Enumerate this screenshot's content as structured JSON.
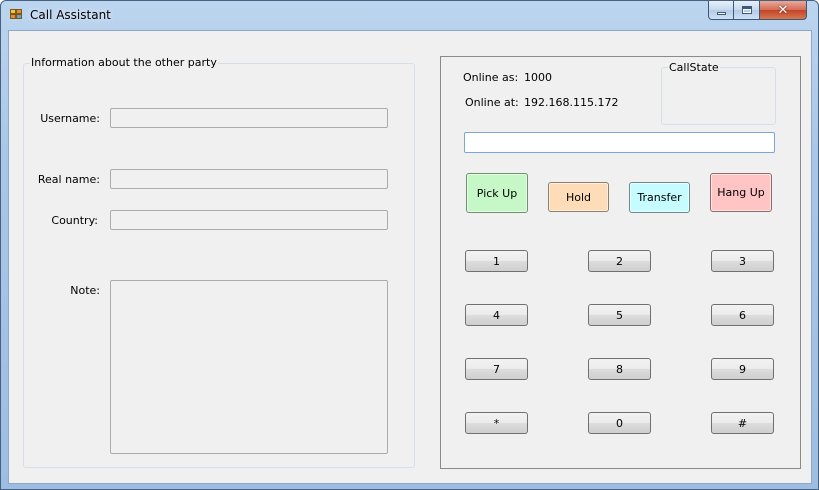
{
  "window": {
    "title": "Call Assistant"
  },
  "caption": {
    "minimize_icon": "minimize-icon",
    "maximize_icon": "maximize-icon",
    "close_icon": "close-icon",
    "close_glyph": "✕"
  },
  "other_party": {
    "legend": "Information about the other party",
    "username_label": "Username:",
    "username_value": "",
    "realname_label": "Real name:",
    "realname_value": "",
    "country_label": "Country:",
    "country_value": "",
    "note_label": "Note:",
    "note_value": ""
  },
  "status": {
    "online_as_label": "Online as:",
    "online_as_value": "1000",
    "online_at_label": "Online at:",
    "online_at_value": "192.168.115.172",
    "callstate_legend": "CallState",
    "callstate_value": ""
  },
  "dial": {
    "number_value": ""
  },
  "actions": {
    "pickup": "Pick Up",
    "hold": "Hold",
    "transfer": "Transfer",
    "hangup": "Hang Up"
  },
  "keypad": [
    "1",
    "2",
    "3",
    "4",
    "5",
    "6",
    "7",
    "8",
    "9",
    "*",
    "0",
    "#"
  ],
  "colors": {
    "pickup": "#c6f7c6",
    "hold": "#ffdcb8",
    "transfer": "#c6fcff",
    "hangup": "#ffc4c4"
  }
}
